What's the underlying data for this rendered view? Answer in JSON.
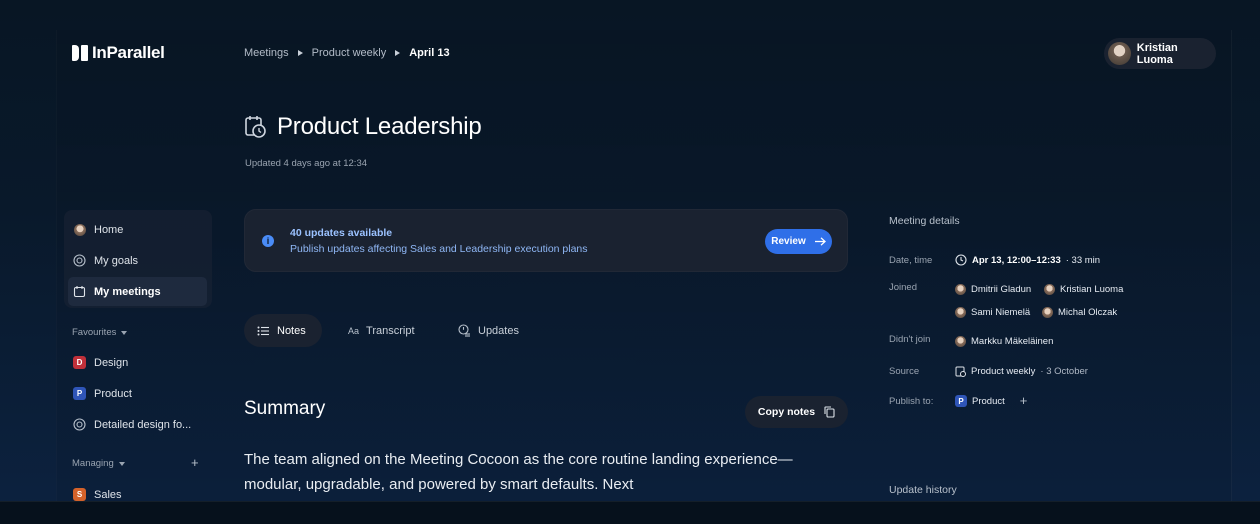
{
  "app": {
    "logo_text": "InParallel"
  },
  "breadcrumb": {
    "items": [
      "Meetings",
      "Product weekly"
    ],
    "current": "April 13"
  },
  "user": {
    "name": "Kristian Luoma"
  },
  "page": {
    "title": "Product Leadership",
    "updated": "Updated 4 days ago at 12:34"
  },
  "sidebar": {
    "items": [
      {
        "label": "Home",
        "icon": "avatar-icon"
      },
      {
        "label": "My goals",
        "icon": "target-icon"
      },
      {
        "label": "My meetings",
        "icon": "calendar-icon"
      }
    ],
    "favourites_label": "Favourites",
    "favourites": [
      {
        "label": "Design",
        "letter": "D",
        "color": "#c0303a"
      },
      {
        "label": "Product",
        "letter": "P",
        "color": "#2f55b8"
      },
      {
        "label": "Detailed design fo...",
        "icon": "target-icon"
      }
    ],
    "managing_label": "Managing",
    "managing": [
      {
        "label": "Sales",
        "letter": "S",
        "color": "#d4622a"
      }
    ]
  },
  "banner": {
    "title": "40 updates available",
    "subtitle": "Publish updates affecting Sales and Leadership execution plans",
    "button": "Review"
  },
  "tabs": [
    {
      "label": "Notes",
      "icon": "list-icon"
    },
    {
      "label": "Transcript",
      "icon": "text-icon"
    },
    {
      "label": "Updates",
      "icon": "updates-icon"
    }
  ],
  "summary": {
    "title": "Summary",
    "copy_label": "Copy notes",
    "text": "The team aligned on the Meeting Cocoon as the core routine landing experience—modular, upgradable, and powered by smart defaults. Next"
  },
  "details": {
    "title": "Meeting details",
    "date_label": "Date, time",
    "date_value": "Apr 13, 12:00–12:33",
    "duration": "· 33 min",
    "joined_label": "Joined",
    "joined": [
      "Dmitrii Gladun",
      "Kristian Luoma",
      "Sami Niemelä",
      "Michal Olczak"
    ],
    "not_joined_label": "Didn't join",
    "not_joined": [
      "Markku Mäkeläinen"
    ],
    "source_label": "Source",
    "source_value": "Product weekly",
    "source_date": "· 3 October",
    "publish_label": "Publish to:",
    "publish_value": "Product",
    "publish_letter": "P",
    "history_title": "Update history"
  },
  "colors": {
    "accent": "#2f6fe8",
    "info": "#4a8cf7",
    "surface": "#1a2230"
  }
}
